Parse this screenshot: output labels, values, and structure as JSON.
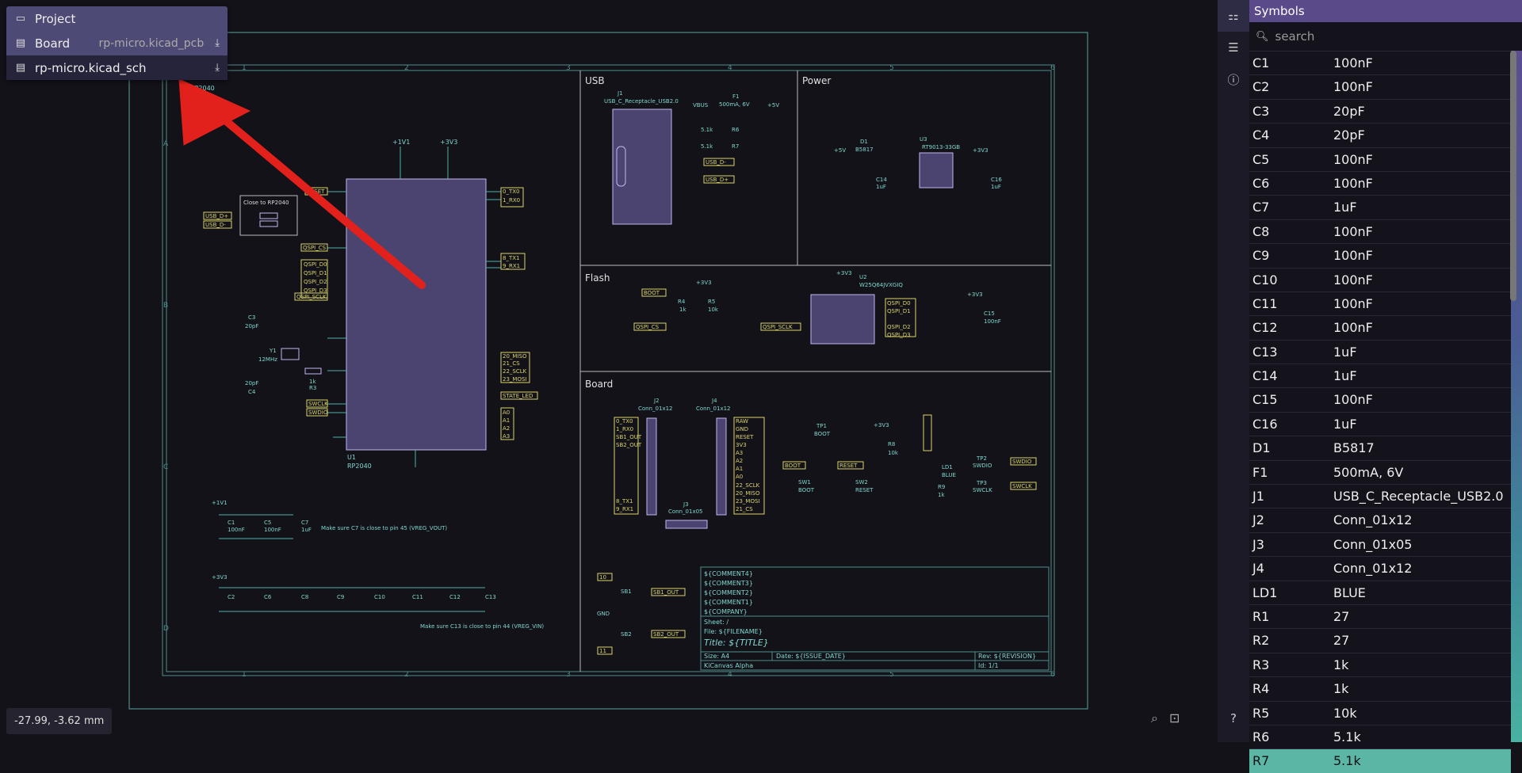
{
  "project": {
    "items": [
      {
        "icon": "folder-icon",
        "label": "Project",
        "filename": "",
        "download": false
      },
      {
        "icon": "board-file-icon",
        "label": "Board",
        "filename": "rp-micro.kicad_pcb",
        "download": true
      },
      {
        "icon": "schematic-file-icon",
        "label": "rp-micro.kicad_sch",
        "filename": "",
        "download": true
      }
    ]
  },
  "status": {
    "coordinates": "-27.99, -3.62 mm"
  },
  "schematic": {
    "sheet_sections": [
      "USB",
      "Power",
      "Flash",
      "Board"
    ],
    "notes": [
      "Make sure C7 is close to pin 45 (VREG_VOUT)",
      "Make sure C13 is close to pin 44 (VREG_VIN)",
      "Close to RP2040"
    ],
    "components": [
      "U1 RP2040",
      "J1 USB_C_Receptacle_USB2.0",
      "U3 RT9013-33GB",
      "U2 W25Q64JVXGIQ",
      "J2 Conn_01x12",
      "J4 Conn_01x12",
      "J3 Conn_01x05",
      "F1 500mA, 6V",
      "D1 B5817"
    ],
    "title_block": {
      "comments": [
        "${COMMENT4}",
        "${COMMENT3}",
        "${COMMENT2}",
        "${COMMENT1}",
        "${COMPANY}"
      ],
      "sheet": "Sheet: /",
      "file": "File: ${FILENAME}",
      "title": "Title: ${TITLE}",
      "size": "Size: A4",
      "date": "Date: ${ISSUE_DATE}",
      "rev": "Rev: ${REVISION}",
      "app": "KiCanvas Alpha",
      "id": "Id: 1/1"
    }
  },
  "symbols_panel": {
    "title": "Symbols",
    "search_placeholder": "search",
    "rows": [
      {
        "ref": "C1",
        "value": "100nF"
      },
      {
        "ref": "C2",
        "value": "100nF"
      },
      {
        "ref": "C3",
        "value": "20pF"
      },
      {
        "ref": "C4",
        "value": "20pF"
      },
      {
        "ref": "C5",
        "value": "100nF"
      },
      {
        "ref": "C6",
        "value": "100nF"
      },
      {
        "ref": "C7",
        "value": "1uF"
      },
      {
        "ref": "C8",
        "value": "100nF"
      },
      {
        "ref": "C9",
        "value": "100nF"
      },
      {
        "ref": "C10",
        "value": "100nF"
      },
      {
        "ref": "C11",
        "value": "100nF"
      },
      {
        "ref": "C12",
        "value": "100nF"
      },
      {
        "ref": "C13",
        "value": "1uF"
      },
      {
        "ref": "C14",
        "value": "1uF"
      },
      {
        "ref": "C15",
        "value": "100nF"
      },
      {
        "ref": "C16",
        "value": "1uF"
      },
      {
        "ref": "D1",
        "value": "B5817"
      },
      {
        "ref": "F1",
        "value": "500mA, 6V"
      },
      {
        "ref": "J1",
        "value": "USB_C_Receptacle_USB2.0"
      },
      {
        "ref": "J2",
        "value": "Conn_01x12"
      },
      {
        "ref": "J3",
        "value": "Conn_01x05"
      },
      {
        "ref": "J4",
        "value": "Conn_01x12"
      },
      {
        "ref": "LD1",
        "value": "BLUE"
      },
      {
        "ref": "R1",
        "value": "27"
      },
      {
        "ref": "R2",
        "value": "27"
      },
      {
        "ref": "R3",
        "value": "1k"
      },
      {
        "ref": "R4",
        "value": "1k"
      },
      {
        "ref": "R5",
        "value": "10k"
      },
      {
        "ref": "R6",
        "value": "5.1k"
      },
      {
        "ref": "R7",
        "value": "5.1k"
      }
    ]
  },
  "colors": {
    "canvas_bg": "#131218",
    "schematic_line": "#4f8e8a",
    "wire": "#4fb0a8",
    "label": "#d9d36a",
    "component_fill": "#4b4470",
    "annotation_arrow": "#e3211c"
  }
}
